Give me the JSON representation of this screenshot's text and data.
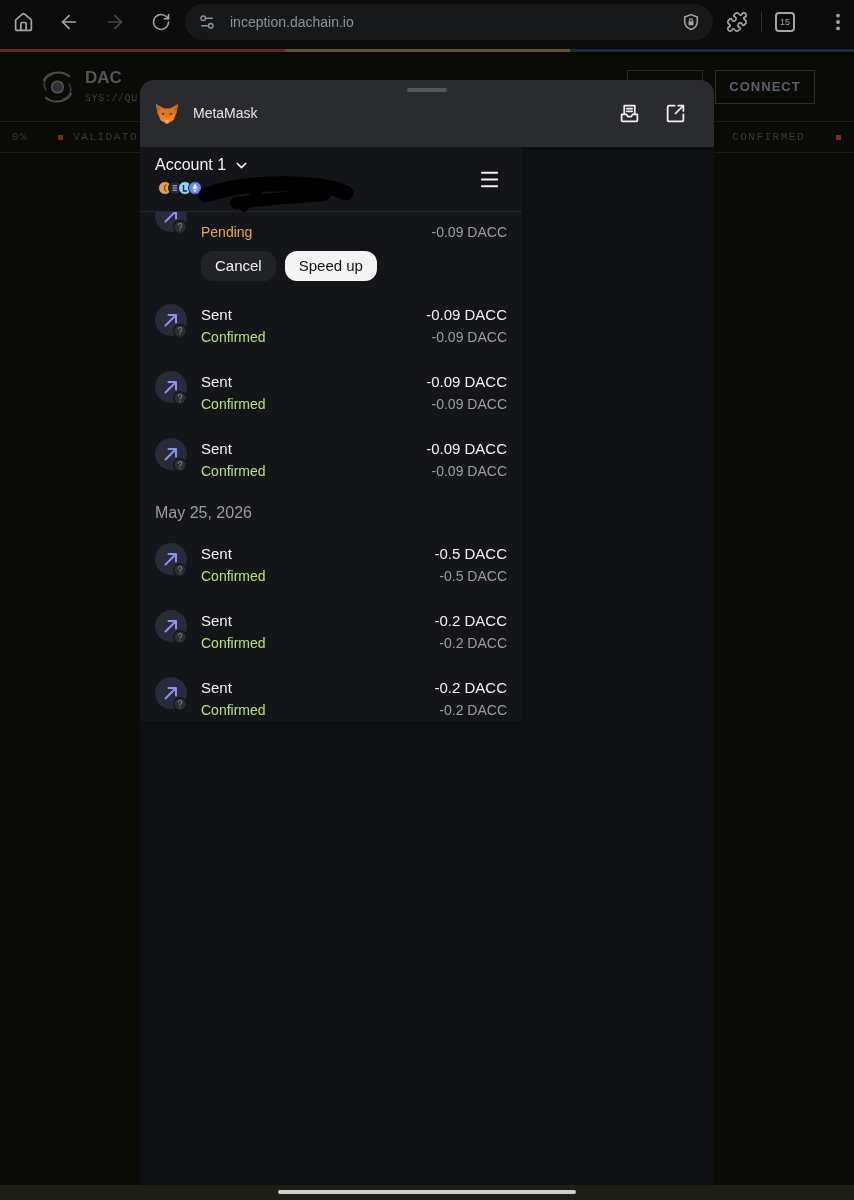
{
  "browser": {
    "url": "inception.dachain.io",
    "tab_count": "15",
    "forward_disabled": true
  },
  "site": {
    "brand": "DAC",
    "tagline": "SYS://QU",
    "connect": "CONNECT",
    "ticker_left": [
      {
        "text": "0%",
        "marker": false
      },
      {
        "text": "VALIDATO",
        "marker": true
      }
    ],
    "ticker_right": [
      {
        "text": "CONFIRMED",
        "marker": false
      }
    ]
  },
  "sheet": {
    "title": "MetaMask"
  },
  "account": {
    "name": "Account 1"
  },
  "activity": [
    {
      "kind": "pending",
      "partially_hidden": true,
      "status": "Pending",
      "fiat": "-0.09 DACC",
      "actions": [
        {
          "label": "Cancel",
          "primary": false
        },
        {
          "label": "Speed up",
          "primary": true
        }
      ]
    },
    {
      "kind": "confirmed",
      "partially_hidden": false,
      "title": "Sent",
      "status": "Confirmed",
      "amount": "-0.09 DACC",
      "fiat": "-0.09 DACC"
    },
    {
      "kind": "confirmed",
      "partially_hidden": false,
      "title": "Sent",
      "status": "Confirmed",
      "amount": "-0.09 DACC",
      "fiat": "-0.09 DACC"
    },
    {
      "kind": "confirmed",
      "partially_hidden": false,
      "title": "Sent",
      "status": "Confirmed",
      "amount": "-0.09 DACC",
      "fiat": "-0.09 DACC"
    },
    {
      "kind": "date",
      "label": "May 25, 2026"
    },
    {
      "kind": "confirmed",
      "partially_hidden": false,
      "title": "Sent",
      "status": "Confirmed",
      "amount": "-0.5 DACC",
      "fiat": "-0.5 DACC"
    },
    {
      "kind": "confirmed",
      "partially_hidden": false,
      "title": "Sent",
      "status": "Confirmed",
      "amount": "-0.2 DACC",
      "fiat": "-0.2 DACC"
    },
    {
      "kind": "confirmed",
      "partially_hidden": false,
      "title": "Sent",
      "status": "Confirmed",
      "amount": "-0.2 DACC",
      "fiat": "-0.2 DACC"
    }
  ]
}
